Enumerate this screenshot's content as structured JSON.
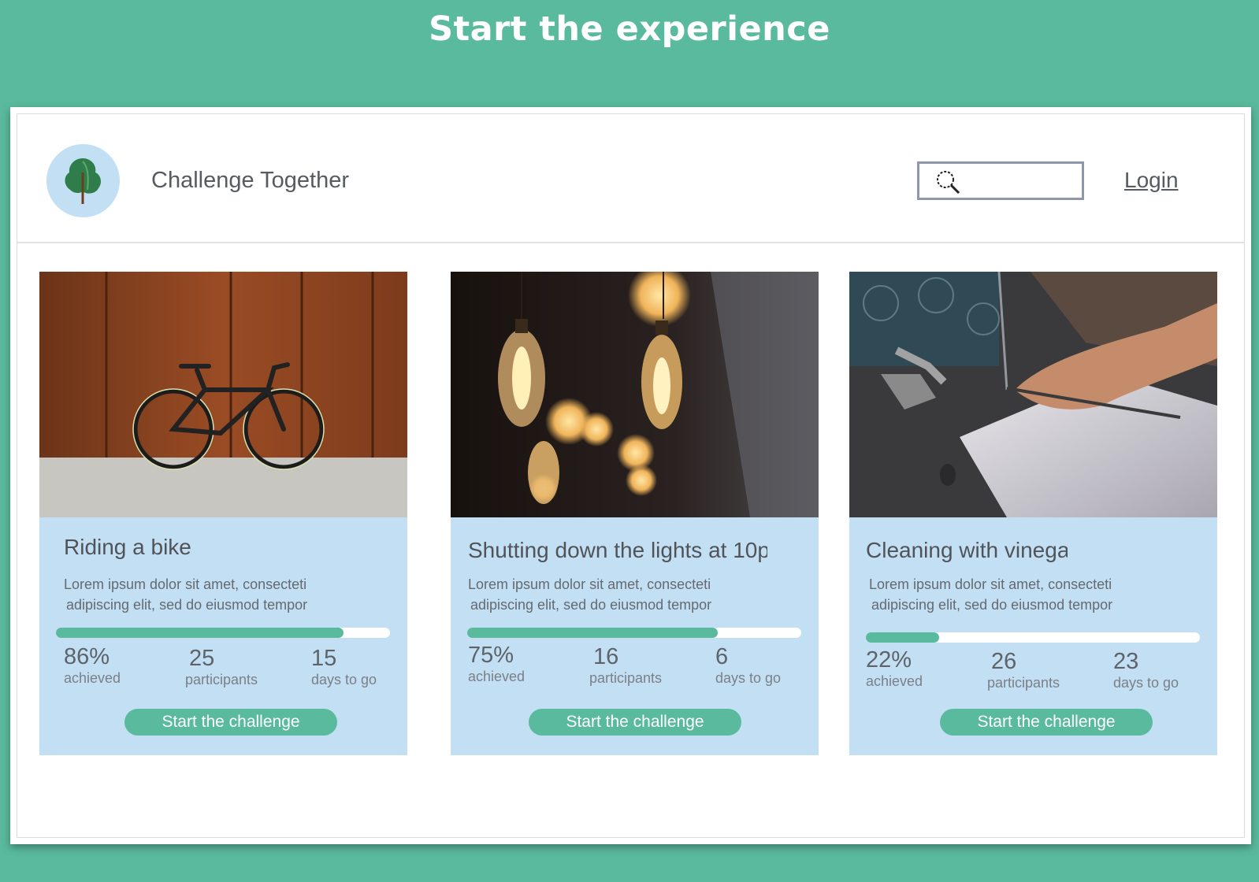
{
  "banner": {
    "title": "Start the experience"
  },
  "header": {
    "logo_icon": "tree-icon",
    "app_title": "Challenge Together",
    "search": {
      "icon": "search-icon",
      "value": ""
    },
    "login_label": "Login"
  },
  "colors": {
    "brand_green": "#5aba9e",
    "card_background": "#c3dff4",
    "logo_background": "#c3dff4"
  },
  "cards": [
    {
      "image": "bicycle against rusted wall",
      "title": "Riding a bike",
      "desc_line1": "Lorem ipsum dolor sit amet, consecteti",
      "desc_line2": "adipiscing elit, sed do eiusmod tempor",
      "progress_percent": 86,
      "achieved_value": "86%",
      "achieved_label": "achieved",
      "participants_value": "25",
      "participants_label": "participants",
      "days_value": "15",
      "days_label": "days to go",
      "button_label": "Start the challenge"
    },
    {
      "image": "hanging edison light bulbs",
      "title": "Shutting down the lights at 10p",
      "desc_line1": "Lorem ipsum dolor sit amet, consecteti",
      "desc_line2": "adipiscing elit, sed do eiusmod tempor",
      "progress_percent": 75,
      "achieved_value": "75%",
      "achieved_label": "achieved",
      "participants_value": "16",
      "participants_label": "participants",
      "days_value": "6",
      "days_label": "days to go",
      "button_label": "Start the challenge"
    },
    {
      "image": "hand washing fork under tap",
      "title": "Cleaning with vinega",
      "desc_line1": "Lorem ipsum dolor sit amet, consecteti",
      "desc_line2": "adipiscing elit, sed do eiusmod tempor",
      "progress_percent": 22,
      "achieved_value": "22%",
      "achieved_label": "achieved",
      "participants_value": "26",
      "participants_label": "participants",
      "days_value": "23",
      "days_label": "days to go",
      "button_label": "Start the challenge"
    }
  ]
}
